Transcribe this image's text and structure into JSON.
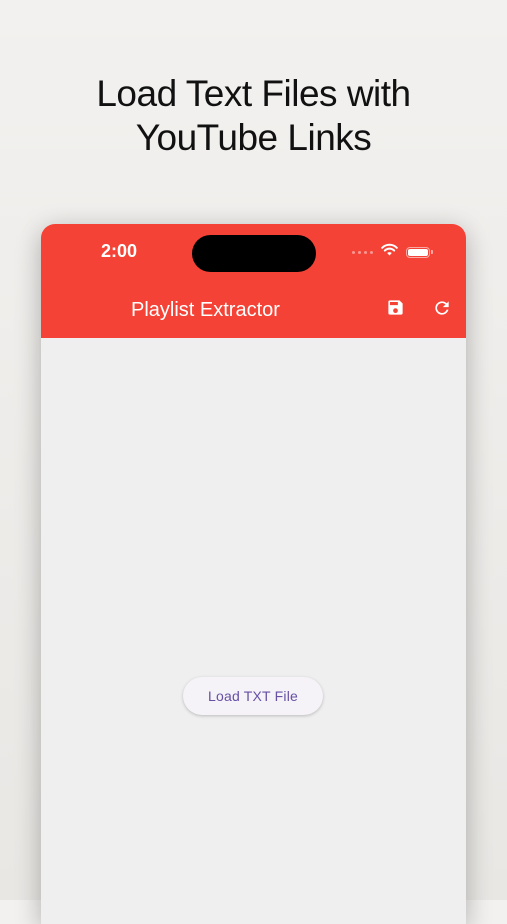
{
  "headline": {
    "line1": "Load Text Files with",
    "line2": "YouTube Links"
  },
  "status_bar": {
    "time": "2:00",
    "icons": [
      "signal-dots-icon",
      "wifi-icon",
      "battery-icon"
    ]
  },
  "app_bar": {
    "title": "Playlist Extractor",
    "background_color": "#f44336",
    "actions": [
      "save-icon",
      "refresh-icon"
    ]
  },
  "main": {
    "load_button_label": "Load TXT File",
    "button_text_color": "#6750a4"
  }
}
